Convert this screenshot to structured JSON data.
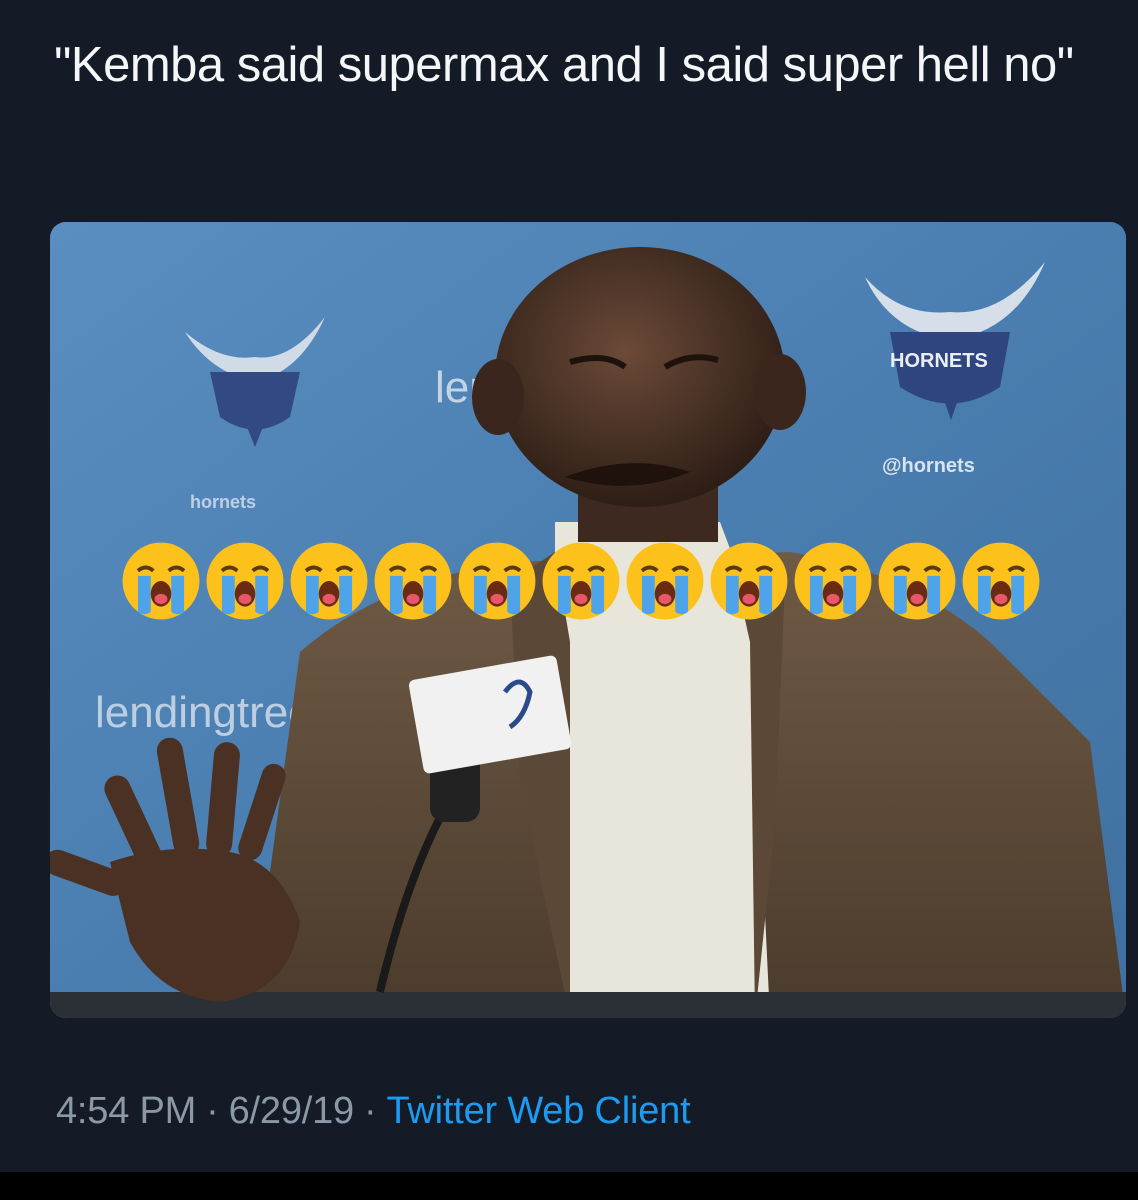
{
  "tweet": {
    "text": "\"Kemba said supermax and I said super hell no\"",
    "time": "4:54 PM",
    "date": "6/29/19",
    "separator": "·",
    "client": "Twitter Web Client"
  },
  "media": {
    "description_icon": "press-conference-photo",
    "backdrop_text": {
      "left_sponsor": "lendingtree",
      "mid_sponsor": "len",
      "handle": "@hornets",
      "team": "HORNETS",
      "left_hashtag": "hornets"
    },
    "emoji": {
      "name": "loudly-crying-face-icon",
      "count": 11
    }
  },
  "colors": {
    "background": "#141b26",
    "text": "#f4f6f8",
    "muted": "#8b98a5",
    "link": "#1d9bf0",
    "backdrop_blue": "#4c7fb0"
  }
}
